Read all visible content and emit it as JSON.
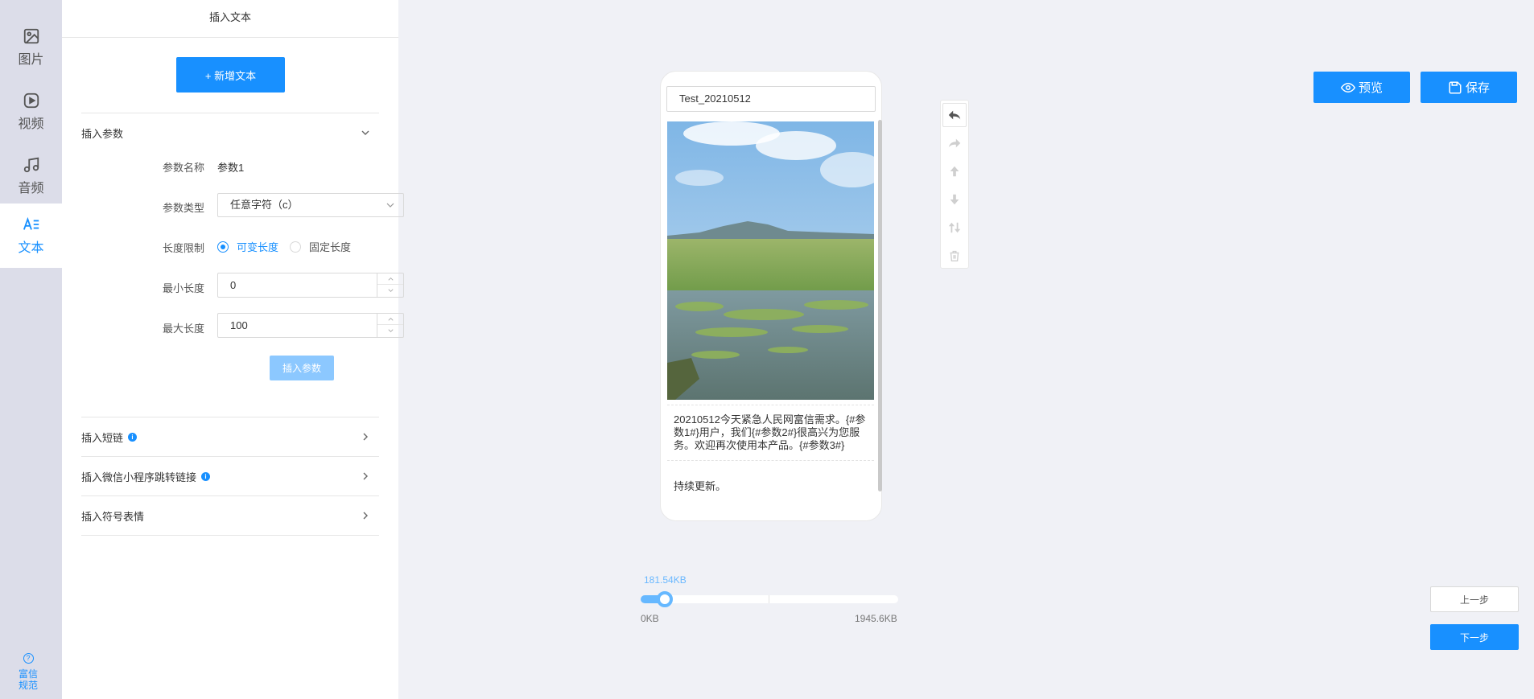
{
  "rail": {
    "items": [
      {
        "label": "图片",
        "icon": "image-icon"
      },
      {
        "label": "视频",
        "icon": "video-icon"
      },
      {
        "label": "音频",
        "icon": "music-icon"
      },
      {
        "label": "文本",
        "icon": "text-icon",
        "active": true
      }
    ],
    "help_line1": "富信",
    "help_line2": "规范"
  },
  "panel": {
    "title": "插入文本",
    "add_text_label": "+ 新增文本",
    "param_section": {
      "title": "插入参数",
      "name_label": "参数名称",
      "name_value": "参数1",
      "type_label": "参数类型",
      "type_value": "任意字符（c）",
      "length_limit_label": "长度限制",
      "length_options": [
        "可变长度",
        "固定长度"
      ],
      "length_selected": "可变长度",
      "min_label": "最小长度",
      "min_value": "0",
      "max_label": "最大长度",
      "max_value": "100",
      "insert_label": "插入参数"
    },
    "sections": [
      {
        "title": "插入短链",
        "info": true
      },
      {
        "title": "插入微信小程序跳转链接",
        "info": true
      },
      {
        "title": "插入符号表情",
        "info": false
      }
    ]
  },
  "phone": {
    "title_value": "Test_20210512",
    "body_text": "20210512今天紧急人民网富信需求。{#参数1#}用户，我们{#参数2#}很高兴为您服务。欢迎再次使用本产品。{#参数3#}",
    "body_text2": "持续更新。"
  },
  "toolbar": {
    "tools": [
      "undo-icon",
      "redo-icon",
      "move-up-icon",
      "move-down-icon",
      "swap-icon",
      "delete-icon"
    ]
  },
  "actions": {
    "preview_label": "预览",
    "save_label": "保存",
    "prev_label": "上一步",
    "next_label": "下一步"
  },
  "size": {
    "current_label": "181.54KB",
    "min_label": "0KB",
    "max_label": "1945.6KB",
    "current_kb": 181.54,
    "max_kb": 1945.6
  },
  "colors": {
    "primary": "#1890ff",
    "disabled_primary": "#8cc8ff",
    "rail_bg": "#dcdde9",
    "canvas_bg": "#f0f1f6"
  }
}
